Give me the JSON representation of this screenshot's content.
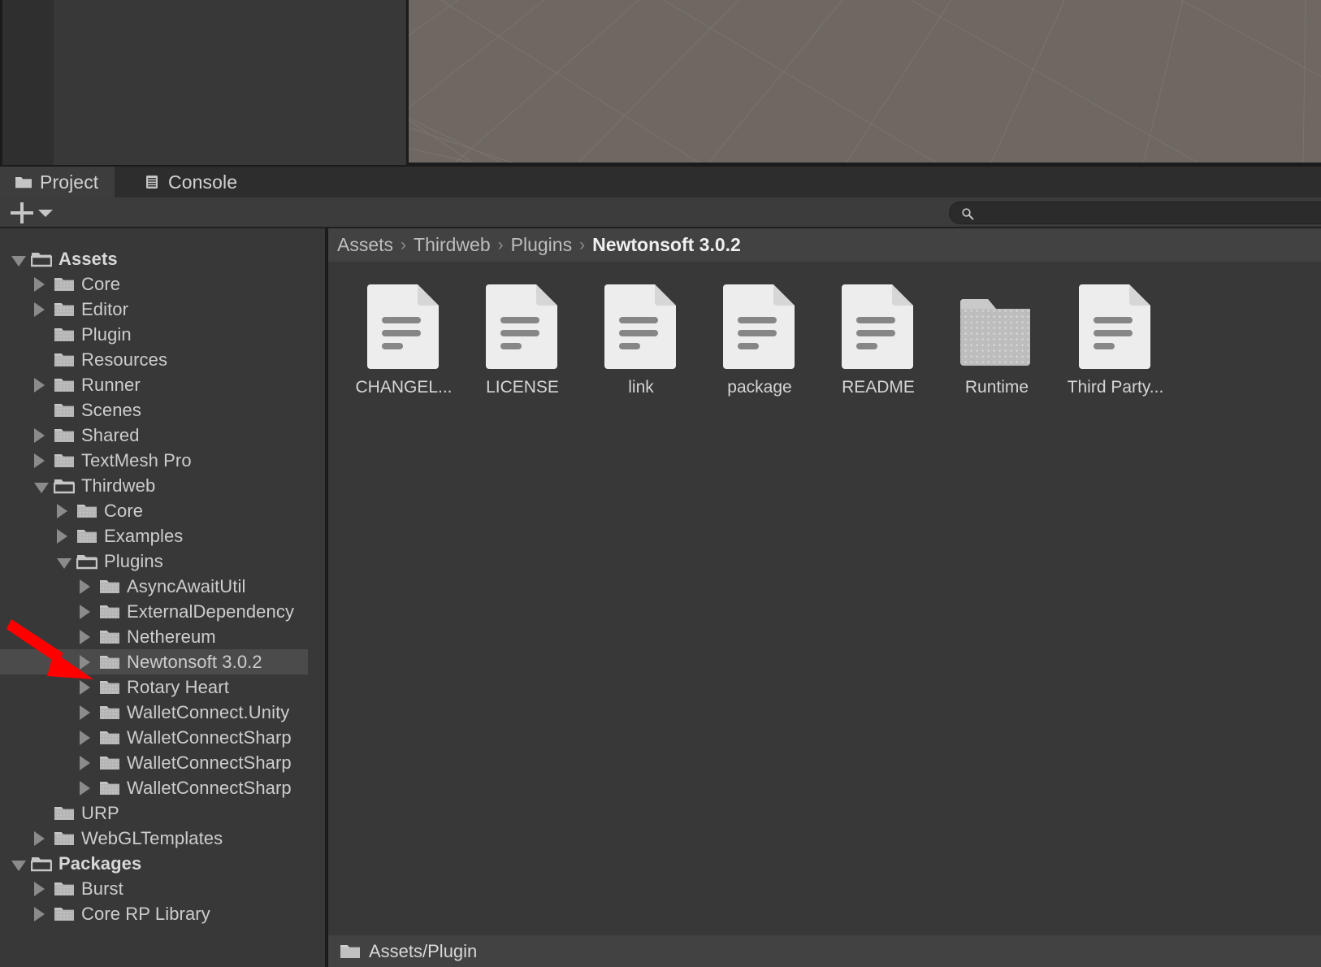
{
  "window": {
    "scene_view": {
      "name": "scene-view",
      "background_color": "#6e6762",
      "grid_color": "#7d7670"
    },
    "panel_bg": "#383838",
    "accent_arrow_color": "#fe0000"
  },
  "tabs": [
    {
      "label": "Project",
      "icon": "folder-icon",
      "active": true
    },
    {
      "label": "Console",
      "icon": "console-icon",
      "active": false
    }
  ],
  "toolbar": {
    "add_label": "+",
    "add_dropdown_label": "▾",
    "search": {
      "placeholder": "",
      "value": "",
      "icon": "search-icon"
    }
  },
  "breadcrumb": {
    "separator": "›",
    "items": [
      {
        "label": "Assets",
        "current": false
      },
      {
        "label": "Thirdweb",
        "current": false
      },
      {
        "label": "Plugins",
        "current": false
      },
      {
        "label": "Newtonsoft 3.0.2",
        "current": true
      }
    ]
  },
  "assets": [
    {
      "label": "CHANGEL...",
      "type": "file"
    },
    {
      "label": "LICENSE",
      "type": "file"
    },
    {
      "label": "link",
      "type": "file"
    },
    {
      "label": "package",
      "type": "file"
    },
    {
      "label": "README",
      "type": "file"
    },
    {
      "label": "Runtime",
      "type": "folder"
    },
    {
      "label": "Third Party...",
      "type": "file"
    }
  ],
  "tree": {
    "rows": [
      {
        "label": "Assets",
        "depth": 0,
        "fold": "open",
        "icon": "folder-open-icon",
        "bold": true,
        "selected": false
      },
      {
        "label": "Core",
        "depth": 1,
        "fold": "closed",
        "icon": "folder-icon",
        "bold": false,
        "selected": false
      },
      {
        "label": "Editor",
        "depth": 1,
        "fold": "closed",
        "icon": "folder-icon",
        "bold": false,
        "selected": false
      },
      {
        "label": "Plugin",
        "depth": 1,
        "fold": "none",
        "icon": "folder-icon",
        "bold": false,
        "selected": false
      },
      {
        "label": "Resources",
        "depth": 1,
        "fold": "none",
        "icon": "folder-icon",
        "bold": false,
        "selected": false
      },
      {
        "label": "Runner",
        "depth": 1,
        "fold": "closed",
        "icon": "folder-icon",
        "bold": false,
        "selected": false
      },
      {
        "label": "Scenes",
        "depth": 1,
        "fold": "none",
        "icon": "folder-icon",
        "bold": false,
        "selected": false
      },
      {
        "label": "Shared",
        "depth": 1,
        "fold": "closed",
        "icon": "folder-icon",
        "bold": false,
        "selected": false
      },
      {
        "label": "TextMesh Pro",
        "depth": 1,
        "fold": "closed",
        "icon": "folder-icon",
        "bold": false,
        "selected": false
      },
      {
        "label": "Thirdweb",
        "depth": 1,
        "fold": "open",
        "icon": "folder-open-icon",
        "bold": false,
        "selected": false
      },
      {
        "label": "Core",
        "depth": 2,
        "fold": "closed",
        "icon": "folder-icon",
        "bold": false,
        "selected": false
      },
      {
        "label": "Examples",
        "depth": 2,
        "fold": "closed",
        "icon": "folder-icon",
        "bold": false,
        "selected": false
      },
      {
        "label": "Plugins",
        "depth": 2,
        "fold": "open",
        "icon": "folder-open-icon",
        "bold": false,
        "selected": false
      },
      {
        "label": "AsyncAwaitUtil",
        "depth": 3,
        "fold": "closed",
        "icon": "folder-icon",
        "bold": false,
        "selected": false
      },
      {
        "label": "ExternalDependency",
        "depth": 3,
        "fold": "closed",
        "icon": "folder-icon",
        "bold": false,
        "selected": false
      },
      {
        "label": "Nethereum",
        "depth": 3,
        "fold": "closed",
        "icon": "folder-icon",
        "bold": false,
        "selected": false
      },
      {
        "label": "Newtonsoft 3.0.2",
        "depth": 3,
        "fold": "closed",
        "icon": "folder-icon",
        "bold": false,
        "selected": true
      },
      {
        "label": "Rotary Heart",
        "depth": 3,
        "fold": "closed",
        "icon": "folder-icon",
        "bold": false,
        "selected": false
      },
      {
        "label": "WalletConnect.Unity",
        "depth": 3,
        "fold": "closed",
        "icon": "folder-icon",
        "bold": false,
        "selected": false
      },
      {
        "label": "WalletConnectSharp",
        "depth": 3,
        "fold": "closed",
        "icon": "folder-icon",
        "bold": false,
        "selected": false
      },
      {
        "label": "WalletConnectSharp",
        "depth": 3,
        "fold": "closed",
        "icon": "folder-icon",
        "bold": false,
        "selected": false
      },
      {
        "label": "WalletConnectSharp",
        "depth": 3,
        "fold": "closed",
        "icon": "folder-icon",
        "bold": false,
        "selected": false
      },
      {
        "label": "URP",
        "depth": 1,
        "fold": "none",
        "icon": "folder-icon",
        "bold": false,
        "selected": false
      },
      {
        "label": "WebGLTemplates",
        "depth": 1,
        "fold": "closed",
        "icon": "folder-icon",
        "bold": false,
        "selected": false
      },
      {
        "label": "Packages",
        "depth": 0,
        "fold": "open",
        "icon": "folder-open-icon",
        "bold": true,
        "selected": false
      },
      {
        "label": "Burst",
        "depth": 1,
        "fold": "closed",
        "icon": "folder-icon",
        "bold": false,
        "selected": false
      },
      {
        "label": "Core RP Library",
        "depth": 1,
        "fold": "closed",
        "icon": "folder-icon",
        "bold": false,
        "selected": false
      }
    ]
  },
  "statusbar": {
    "path": "Assets/Plugin",
    "icon": "folder-icon"
  }
}
